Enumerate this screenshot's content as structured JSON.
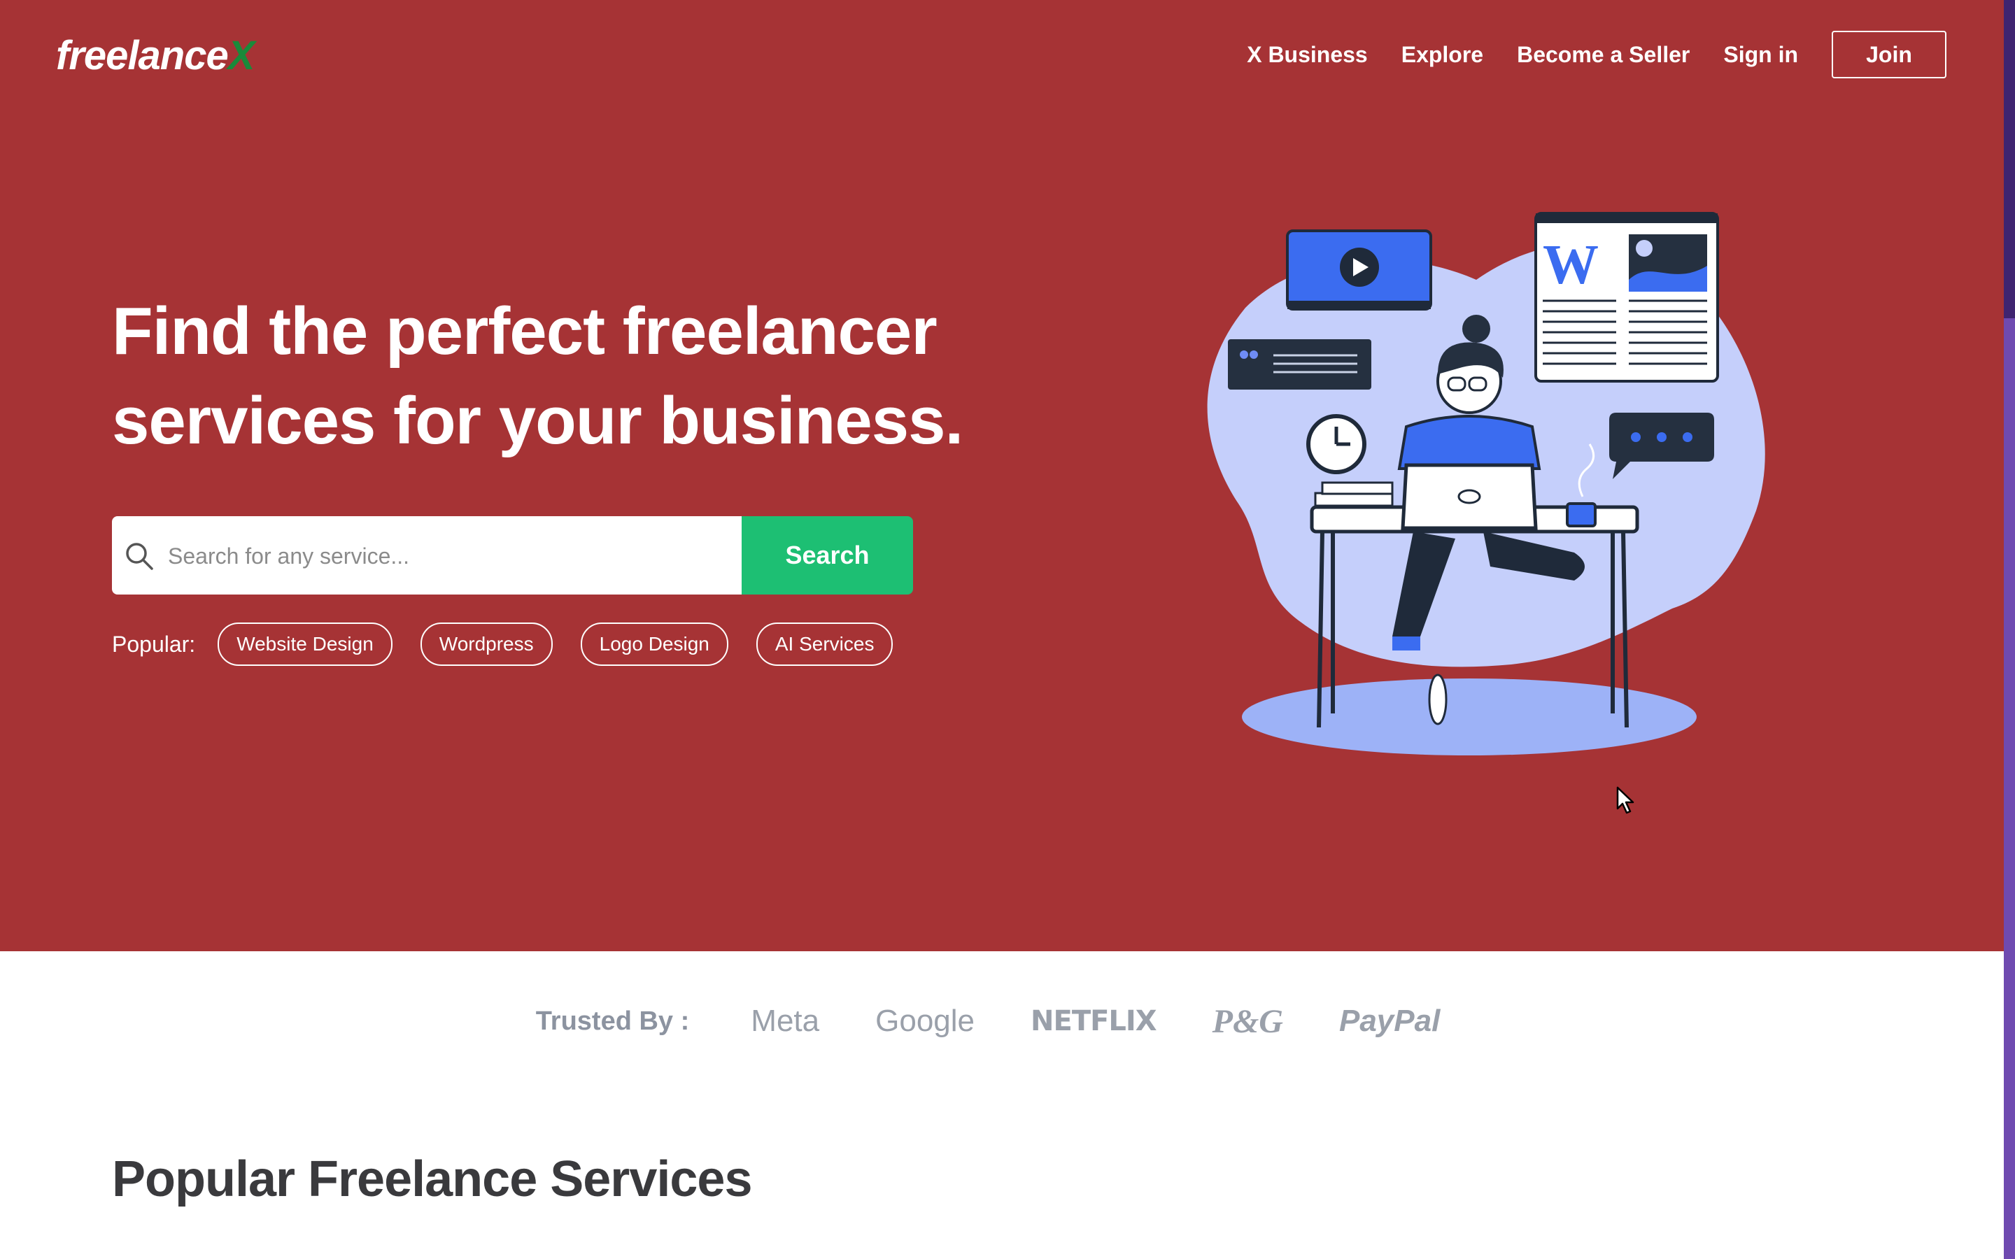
{
  "brand": {
    "name": "freelance",
    "name_accent": "X"
  },
  "nav": {
    "items": [
      {
        "label": "X Business"
      },
      {
        "label": "Explore"
      },
      {
        "label": "Become a Seller"
      },
      {
        "label": "Sign in"
      }
    ],
    "join_label": "Join"
  },
  "hero": {
    "headline_line1": "Find the perfect freelancer",
    "headline_line2": "services for your business.",
    "search_placeholder": "Search for any service...",
    "search_button": "Search",
    "popular_label": "Popular:",
    "popular_tags": [
      "Website Design",
      "Wordpress",
      "Logo Design",
      "AI Services"
    ]
  },
  "trusted": {
    "label": "Trusted By :",
    "brands": [
      "Meta",
      "Google",
      "NETFLIX",
      "P&G",
      "PayPal"
    ]
  },
  "section": {
    "title": "Popular Freelance Services"
  },
  "colors": {
    "hero_bg": "#a63335",
    "accent_green": "#1dbf73",
    "logo_x_green": "#1a8a3a",
    "illustration_blue": "#3b6cf0",
    "illustration_blob": "#c5cffb"
  },
  "icons": [
    "search-icon",
    "play-icon",
    "clock-icon",
    "chat-bubble-icon",
    "cursor-icon"
  ]
}
